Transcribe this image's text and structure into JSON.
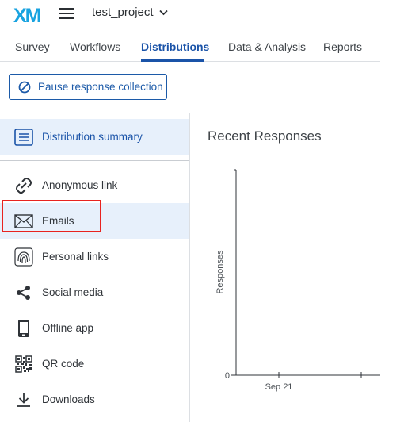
{
  "brand": {
    "logo_text": "XM",
    "accent": "#1a53a8",
    "logo_color": "#19a3e0"
  },
  "header": {
    "project_name": "test_project"
  },
  "tabs": [
    {
      "label": "Survey",
      "active": false
    },
    {
      "label": "Workflows",
      "active": false
    },
    {
      "label": "Distributions",
      "active": true
    },
    {
      "label": "Data & Analysis",
      "active": false
    },
    {
      "label": "Reports",
      "active": false
    }
  ],
  "toolbar": {
    "pause_label": "Pause response collection"
  },
  "sidebar": {
    "summary": {
      "label": "Distribution summary",
      "icon": "list-icon"
    },
    "items": [
      {
        "label": "Anonymous link",
        "icon": "link-icon"
      },
      {
        "label": "Emails",
        "icon": "envelope-icon"
      },
      {
        "label": "Personal links",
        "icon": "fingerprint-icon"
      },
      {
        "label": "Social media",
        "icon": "share-icon"
      },
      {
        "label": "Offline app",
        "icon": "phone-icon"
      },
      {
        "label": "QR code",
        "icon": "qr-code-icon"
      },
      {
        "label": "Downloads",
        "icon": "download-icon"
      }
    ]
  },
  "main": {
    "title": "Recent Responses"
  },
  "chart_data": {
    "type": "bar",
    "ylabel": "Responses",
    "xlabel": "",
    "categories": [
      "Sep 21"
    ],
    "values": [
      0
    ],
    "y_ticks": [
      "0"
    ]
  }
}
